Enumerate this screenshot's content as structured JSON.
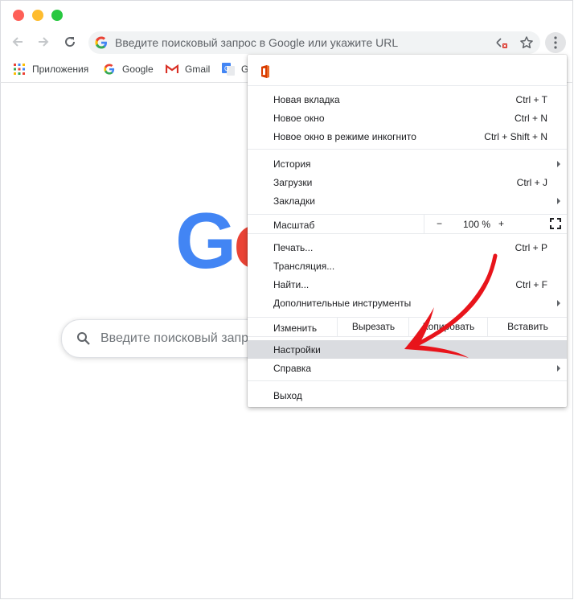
{
  "browser": {
    "omnibox_placeholder": "Введите поисковый запрос в Google или укажите URL"
  },
  "bookmarks": [
    {
      "label": "Приложения",
      "icon": "apps-grid-icon"
    },
    {
      "label": "Google",
      "icon": "google-g-icon"
    },
    {
      "label": "Gmail",
      "icon": "gmail-icon"
    },
    {
      "label": "G",
      "icon": "google-translate-icon"
    }
  ],
  "page": {
    "logo_letters": [
      "G",
      "o"
    ],
    "search_placeholder": "Введите поисковый запрос"
  },
  "menu": {
    "new_tab": {
      "label": "Новая вкладка",
      "shortcut": "Ctrl + T"
    },
    "new_window": {
      "label": "Новое окно",
      "shortcut": "Ctrl + N"
    },
    "incognito": {
      "label": "Новое окно в режиме инкогнито",
      "shortcut": "Ctrl + Shift + N"
    },
    "history": {
      "label": "История"
    },
    "downloads": {
      "label": "Загрузки",
      "shortcut": "Ctrl + J"
    },
    "bookmarks": {
      "label": "Закладки"
    },
    "zoom": {
      "label": "Масштаб",
      "minus": "−",
      "value": "100 %",
      "plus": "+"
    },
    "print": {
      "label": "Печать...",
      "shortcut": "Ctrl + P"
    },
    "cast": {
      "label": "Трансляция..."
    },
    "find": {
      "label": "Найти...",
      "shortcut": "Ctrl + F"
    },
    "more_tools": {
      "label": "Дополнительные инструменты"
    },
    "edit": {
      "label": "Изменить",
      "cut": "Вырезать",
      "copy": "Копировать",
      "paste": "Вставить"
    },
    "settings": {
      "label": "Настройки"
    },
    "help": {
      "label": "Справка"
    },
    "exit": {
      "label": "Выход"
    }
  },
  "colors": {
    "google_blue": "#4285f4",
    "google_red": "#ea4335",
    "annotation_arrow": "#e8141b",
    "highlight": "#dadce0"
  }
}
